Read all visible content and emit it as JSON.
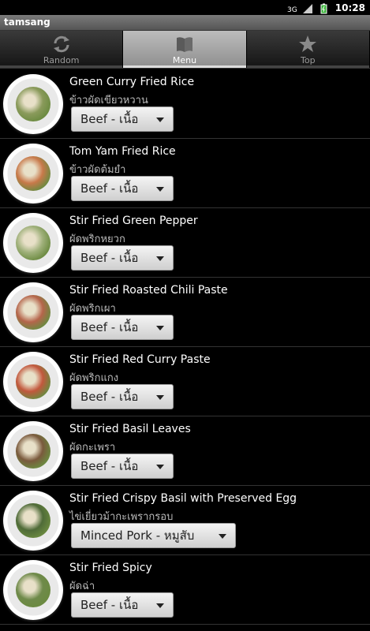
{
  "statusbar": {
    "time": "10:28",
    "icons": [
      "data-3g-icon",
      "signal-icon",
      "battery-icon"
    ]
  },
  "app": {
    "title": "tamsang"
  },
  "tabs": [
    {
      "label": "Random",
      "icon": "refresh-icon",
      "active": false
    },
    {
      "label": "Menu",
      "icon": "book-icon",
      "active": true
    },
    {
      "label": "Top",
      "icon": "star-icon",
      "active": false
    }
  ],
  "menu": [
    {
      "name": "Green Curry Fried Rice",
      "thai": "ข้าวผัดเขียวหวาน",
      "option": "Beef - เนื้อ",
      "color": "#8a9a5b"
    },
    {
      "name": "Tom Yam Fried Rice",
      "thai": "ข้าวผัดต้มยำ",
      "option": "Beef - เนื้อ",
      "color": "#c8794a"
    },
    {
      "name": "Stir Fried Green Pepper",
      "thai": "ผัดพริกหยวก",
      "option": "Beef - เนื้อ",
      "color": "#9fb07a"
    },
    {
      "name": "Stir Fried Roasted Chili Paste",
      "thai": "ผัดพริกเผา",
      "option": "Beef - เนื้อ",
      "color": "#b5654b"
    },
    {
      "name": "Stir Fried Red Curry Paste",
      "thai": "ผัดพริกแกง",
      "option": "Beef - เนื้อ",
      "color": "#c2583d"
    },
    {
      "name": "Stir Fried Basil Leaves",
      "thai": "ผัดกะเพรา",
      "option": "Beef - เนื้อ",
      "color": "#7a5a3d"
    },
    {
      "name": "Stir Fried Crispy Basil with Preserved Egg",
      "thai": "ไข่เยี่ยวม้ากะเพรากรอบ",
      "option": "Minced Pork - หมูสับ",
      "color": "#4f6b38"
    },
    {
      "name": "Stir Fried Spicy",
      "thai": "ผัดฉ่า",
      "option": "Beef - เนื้อ",
      "color": "#6f8a4a"
    }
  ]
}
